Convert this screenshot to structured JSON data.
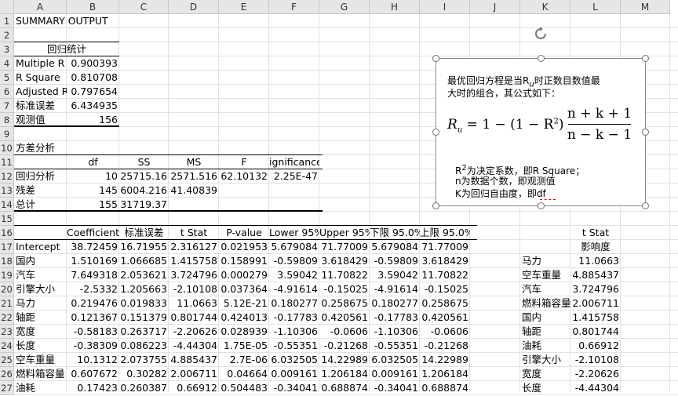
{
  "columns": [
    "A",
    "B",
    "C",
    "D",
    "E",
    "F",
    "G",
    "H",
    "I",
    "J",
    "K",
    "L",
    "M"
  ],
  "rows": [
    "1",
    "2",
    "3",
    "4",
    "5",
    "6",
    "7",
    "8",
    "9",
    "10",
    "11",
    "12",
    "13",
    "14",
    "15",
    "16",
    "17",
    "18",
    "19",
    "20",
    "21",
    "22",
    "23",
    "24",
    "25",
    "26",
    "27"
  ],
  "summary": {
    "title": "SUMMARY OUTPUT",
    "reg_header": "回归统计",
    "stats": [
      {
        "label": "Multiple R",
        "value": "0.900393"
      },
      {
        "label": "R Square",
        "value": "0.810708"
      },
      {
        "label": "Adjusted R",
        "value": "0.797654"
      },
      {
        "label": "标准误差",
        "value": "6.434935"
      },
      {
        "label": "观测值",
        "value": "156"
      }
    ]
  },
  "anova": {
    "title": "方差分析",
    "headers": [
      "df",
      "SS",
      "MS",
      "F",
      "ignificance F"
    ],
    "rows": [
      {
        "label": "回归分析",
        "df": "10",
        "ss": "25715.16",
        "ms": "2571.516",
        "f": "62.10132",
        "sig": "2.25E-47"
      },
      {
        "label": "残差",
        "df": "145",
        "ss": "6004.216",
        "ms": "41.40839",
        "f": "",
        "sig": ""
      },
      {
        "label": "总计",
        "df": "155",
        "ss": "31719.37",
        "ms": "",
        "f": "",
        "sig": ""
      }
    ]
  },
  "coef": {
    "headers": [
      "Coefficients",
      "标准误差",
      "t Stat",
      "P-value",
      "Lower 95%",
      "Upper 95%",
      "下限 95.0%",
      "上限 95.0%"
    ],
    "rows": [
      {
        "label": "Intercept",
        "v": [
          "38.72459",
          "16.71955",
          "2.316127",
          "0.021953",
          "5.679084",
          "71.77009",
          "5.679084",
          "71.77009"
        ]
      },
      {
        "label": "国内",
        "v": [
          "1.510169",
          "1.066685",
          "1.415758",
          "0.158991",
          "-0.59809",
          "3.618429",
          "-0.59809",
          "3.618429"
        ]
      },
      {
        "label": "汽车",
        "v": [
          "7.649318",
          "2.053621",
          "3.724796",
          "0.000279",
          "3.59042",
          "11.70822",
          "3.59042",
          "11.70822"
        ]
      },
      {
        "label": "引擎大小",
        "v": [
          "-2.5332",
          "1.205663",
          "-2.10108",
          "0.037364",
          "-4.91614",
          "-0.15025",
          "-4.91614",
          "-0.15025"
        ]
      },
      {
        "label": "马力",
        "v": [
          "0.219476",
          "0.019833",
          "11.0663",
          "5.12E-21",
          "0.180277",
          "0.258675",
          "0.180277",
          "0.258675"
        ]
      },
      {
        "label": "轴距",
        "v": [
          "0.121367",
          "0.151379",
          "0.801744",
          "0.424013",
          "-0.17783",
          "0.420561",
          "-0.17783",
          "0.420561"
        ]
      },
      {
        "label": "宽度",
        "v": [
          "-0.58183",
          "0.263717",
          "-2.20626",
          "0.028939",
          "-1.10306",
          "-0.0606",
          "-1.10306",
          "-0.0606"
        ]
      },
      {
        "label": "长度",
        "v": [
          "-0.38309",
          "0.086223",
          "-4.44304",
          "1.75E-05",
          "-0.55351",
          "-0.21268",
          "-0.55351",
          "-0.21268"
        ]
      },
      {
        "label": "空车重量",
        "v": [
          "10.1312",
          "2.073755",
          "4.885437",
          "2.7E-06",
          "6.032505",
          "14.22989",
          "6.032505",
          "14.22989"
        ]
      },
      {
        "label": "燃料箱容量",
        "v": [
          "0.607672",
          "0.30282",
          "2.006711",
          "0.04664",
          "0.009161",
          "1.206184",
          "0.009161",
          "1.206184"
        ]
      },
      {
        "label": "油耗",
        "v": [
          "0.17423",
          "0.260387",
          "0.66912",
          "0.504483",
          "-0.34041",
          "0.688874",
          "-0.34041",
          "0.688874"
        ]
      }
    ]
  },
  "ranking": {
    "header1": "t Stat",
    "header2": "影响度",
    "rows": [
      {
        "label": "马力",
        "value": "11.0663"
      },
      {
        "label": "空车重量",
        "value": "4.885437"
      },
      {
        "label": "汽车",
        "value": "3.724796"
      },
      {
        "label": "燃料箱容量",
        "value": "2.006711"
      },
      {
        "label": "国内",
        "value": "1.415758"
      },
      {
        "label": "轴距",
        "value": "0.801744"
      },
      {
        "label": "油耗",
        "value": "0.66912"
      },
      {
        "label": "引擎大小",
        "value": "-2.10108"
      },
      {
        "label": "宽度",
        "value": "-2.20626"
      },
      {
        "label": "长度",
        "value": "-4.44304"
      }
    ]
  },
  "textbox": {
    "line1": "最优回归方程是当R",
    "line1_sub": "u",
    "line1_end": "时正数目数值最",
    "line2": "大时的组合，其公式如下：",
    "formula_lhs": "R",
    "formula_lhs_sub": "u",
    "formula_mid": " = 1 − (1 − R",
    "formula_sup": "2",
    "formula_close": ")",
    "numerator": "n + k + 1",
    "denominator": "n − k − 1",
    "note1_pre": "R",
    "note1_sup": "2",
    "note1": "为决定系数，即R Square；",
    "note2": "n为数据个数，即观测值",
    "note3": "K为回归自由度，即df"
  },
  "icons": {
    "rotate_handle": "rotate-icon"
  }
}
